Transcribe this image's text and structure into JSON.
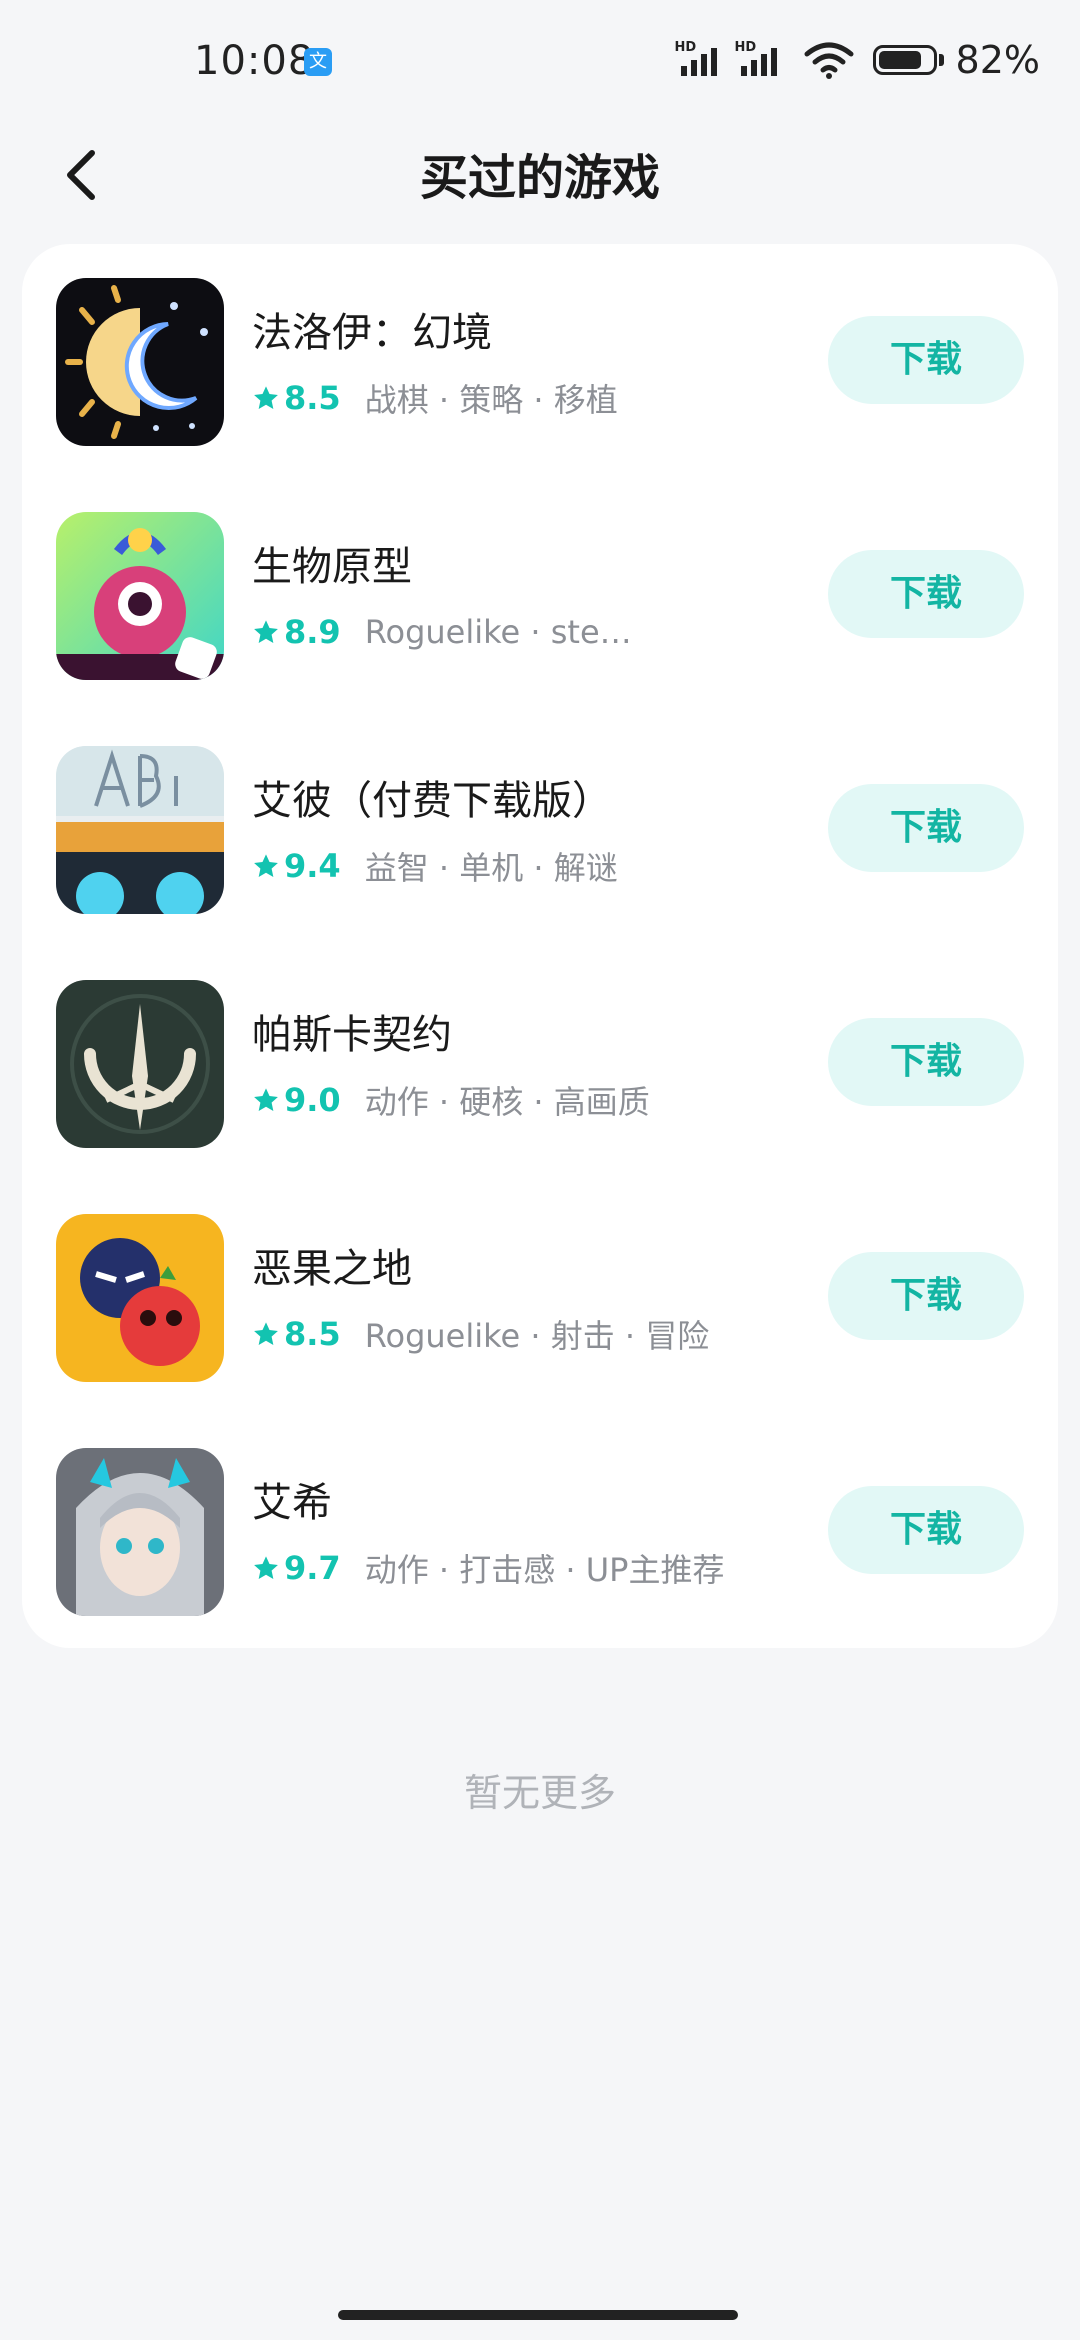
{
  "status": {
    "time": "10:08",
    "app_badge": "文",
    "signal_label": "HD",
    "battery": "82%",
    "battery_level": 0.82
  },
  "nav": {
    "title": "买过的游戏"
  },
  "games": [
    {
      "name": "法洛伊：幻境",
      "rating": "8.5",
      "tags": "战棋 · 策略 · 移植",
      "action": "下载",
      "icon": "sun-moon-icon"
    },
    {
      "name": "生物原型",
      "rating": "8.9",
      "tags": "Roguelike · ste…",
      "action": "下载",
      "icon": "creature-icon"
    },
    {
      "name": "艾彼（付费下载版）",
      "rating": "9.4",
      "tags": "益智 · 单机 · 解谜",
      "action": "下载",
      "icon": "robot-abi-icon"
    },
    {
      "name": "帕斯卡契约",
      "rating": "9.0",
      "tags": "动作 · 硬核 · 高画质",
      "action": "下载",
      "icon": "emblem-icon"
    },
    {
      "name": "恶果之地",
      "rating": "8.5",
      "tags": "Roguelike · 射击 · 冒险",
      "action": "下载",
      "icon": "fruit-icon"
    },
    {
      "name": "艾希",
      "rating": "9.7",
      "tags": "动作 · 打击感 · UP主推荐",
      "action": "下载",
      "icon": "anime-girl-icon"
    }
  ],
  "footer": {
    "end_text": "暂无更多"
  },
  "colors": {
    "accent": "#13c3b0",
    "button_bg": "#e2f8f6",
    "page_bg": "#f5f6f8"
  }
}
